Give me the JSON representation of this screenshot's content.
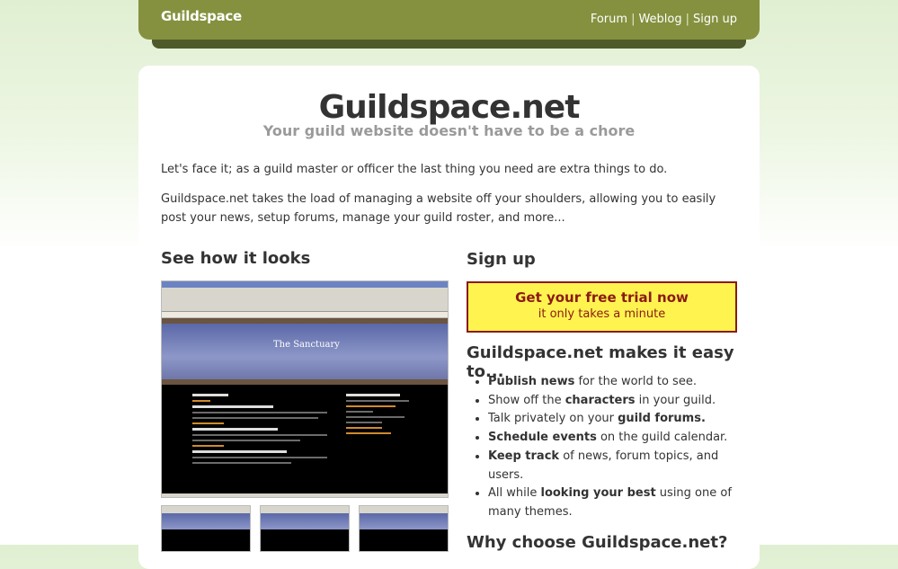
{
  "header": {
    "logo": "Guildspace",
    "nav": [
      {
        "label": "Forum"
      },
      {
        "label": "Weblog"
      },
      {
        "label": "Sign up"
      }
    ],
    "separator": "|"
  },
  "hero": {
    "title": "Guildspace.net",
    "subtitle": "Your guild website doesn't have to be a chore"
  },
  "intro": {
    "p1": "Let's face it; as a guild master or officer the last thing you need are extra things to do.",
    "p2": "Guildspace.net takes the load of managing a website off your shoulders, allowing you to easily post your news, setup forums, manage your guild roster, and more..."
  },
  "see_section": {
    "heading": "See how it looks",
    "screenshot_title": "The Sanctuary"
  },
  "signup_section": {
    "heading": "Sign up",
    "cta_main": "Get your free trial now",
    "cta_sub": "it only takes a minute"
  },
  "easy_section": {
    "heading": "Guildspace.net makes it easy to...",
    "items": [
      {
        "pre": "",
        "bold": "Publish news",
        "post": " for the world to see."
      },
      {
        "pre": "Show off the ",
        "bold": "characters",
        "post": " in your guild."
      },
      {
        "pre": "Talk privately on your ",
        "bold": "guild forums.",
        "post": ""
      },
      {
        "pre": "",
        "bold": "Schedule events",
        "post": " on the guild calendar."
      },
      {
        "pre": "",
        "bold": "Keep track",
        "post": " of news, forum topics, and users."
      },
      {
        "pre": "All while ",
        "bold": "looking your best",
        "post": " using one of many themes."
      }
    ]
  },
  "why_section": {
    "heading": "Why choose Guildspace.net?"
  },
  "colors": {
    "header_green": "#85913f",
    "cta_yellow": "#fff44f",
    "cta_red": "#8a1a16"
  }
}
